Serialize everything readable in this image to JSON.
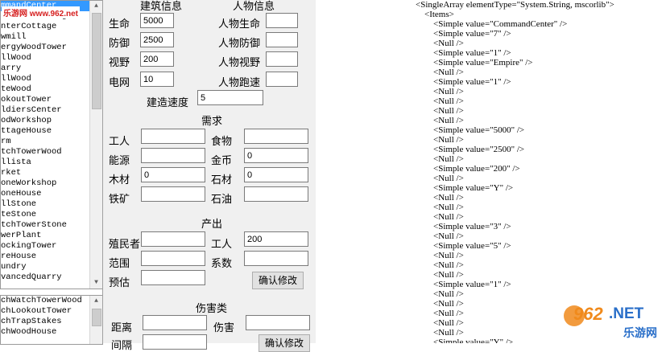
{
  "list_top": {
    "items": [
      "mmandCenter",
      "shermanCottage",
      "nterCottage",
      "wmill",
      "ergyWoodTower",
      "llWood",
      "arry",
      "llWood",
      "teWood",
      "okoutTower",
      "ldiersCenter",
      "odWorkshop",
      "ttageHouse",
      "rm",
      "tchTowerWood",
      "llista",
      "rket",
      "oneWorkshop",
      "oneHouse",
      "llStone",
      "teStone",
      "tchTowerStone",
      "werPlant",
      "ockingTower",
      "reHouse",
      "undry",
      "vancedQuarry"
    ],
    "selected_index": 0
  },
  "list_bottom": {
    "items": [
      "chWatchTowerWood",
      "chLookoutTower",
      "chTrapStakes",
      "chWoodHouse"
    ]
  },
  "watermark_small": "乐游网 www.962.net",
  "form": {
    "building_header": "建筑信息",
    "character_header": "人物信息",
    "building": [
      {
        "label": "生命",
        "value": "5000"
      },
      {
        "label": "防御",
        "value": "2500"
      },
      {
        "label": "视野",
        "value": "200"
      },
      {
        "label": "电网",
        "value": "10"
      }
    ],
    "character": [
      {
        "label": "人物生命",
        "value": ""
      },
      {
        "label": "人物防御",
        "value": ""
      },
      {
        "label": "人物视野",
        "value": ""
      },
      {
        "label": "人物跑速",
        "value": ""
      }
    ],
    "build_speed": {
      "label": "建造速度",
      "value": "5"
    },
    "needs_header": "需求",
    "needs": [
      {
        "label": "工人",
        "value": ""
      },
      {
        "label": "食物",
        "value": ""
      },
      {
        "label": "能源",
        "value": ""
      },
      {
        "label": "金币",
        "value": "0"
      },
      {
        "label": "木材",
        "value": "0"
      },
      {
        "label": "石材",
        "value": "0"
      },
      {
        "label": "铁矿",
        "value": ""
      },
      {
        "label": "石油",
        "value": ""
      }
    ],
    "output_header": "产出",
    "output": [
      {
        "label": "殖民者",
        "value": ""
      },
      {
        "label": "工人",
        "value": "200"
      },
      {
        "label": "范围",
        "value": ""
      },
      {
        "label": "系数",
        "value": ""
      },
      {
        "label": "预估",
        "value": ""
      }
    ],
    "confirm_label": "确认修改",
    "damage_header": "伤害类",
    "damage": [
      {
        "label": "距离",
        "value": ""
      },
      {
        "label": "伤害",
        "value": ""
      },
      {
        "label": "间隔",
        "value": ""
      }
    ],
    "confirm2_label": "确认修改"
  },
  "xml": {
    "lines": [
      {
        "indent": 0,
        "text": "<SingleArray elementType=\"System.String, mscorlib\">"
      },
      {
        "indent": 1,
        "text": "<Items>"
      },
      {
        "indent": 2,
        "text": "<Simple value=\"CommandCenter\" />"
      },
      {
        "indent": 2,
        "text": "<Simple value=\"7\" />"
      },
      {
        "indent": 2,
        "text": "<Null />"
      },
      {
        "indent": 2,
        "text": "<Simple value=\"1\" />"
      },
      {
        "indent": 2,
        "text": "<Simple value=\"Empire\" />"
      },
      {
        "indent": 2,
        "text": "<Null />"
      },
      {
        "indent": 2,
        "text": "<Simple value=\"1\" />"
      },
      {
        "indent": 2,
        "text": "<Null />"
      },
      {
        "indent": 2,
        "text": "<Null />"
      },
      {
        "indent": 2,
        "text": "<Null />"
      },
      {
        "indent": 2,
        "text": "<Null />"
      },
      {
        "indent": 2,
        "text": "<Simple value=\"5000\" />"
      },
      {
        "indent": 2,
        "text": "<Null />"
      },
      {
        "indent": 2,
        "text": "<Simple value=\"2500\" />"
      },
      {
        "indent": 2,
        "text": "<Null />"
      },
      {
        "indent": 2,
        "text": "<Simple value=\"200\" />"
      },
      {
        "indent": 2,
        "text": "<Null />"
      },
      {
        "indent": 2,
        "text": "<Simple value=\"Y\" />"
      },
      {
        "indent": 2,
        "text": "<Null />"
      },
      {
        "indent": 2,
        "text": "<Null />"
      },
      {
        "indent": 2,
        "text": "<Null />"
      },
      {
        "indent": 2,
        "text": "<Simple value=\"3\" />"
      },
      {
        "indent": 2,
        "text": "<Null />"
      },
      {
        "indent": 2,
        "text": "<Simple value=\"5\" />"
      },
      {
        "indent": 2,
        "text": "<Null />"
      },
      {
        "indent": 2,
        "text": "<Null />"
      },
      {
        "indent": 2,
        "text": "<Null />"
      },
      {
        "indent": 2,
        "text": "<Simple value=\"1\" />"
      },
      {
        "indent": 2,
        "text": "<Null />"
      },
      {
        "indent": 2,
        "text": "<Null />"
      },
      {
        "indent": 2,
        "text": "<Null />"
      },
      {
        "indent": 2,
        "text": "<Null />"
      },
      {
        "indent": 2,
        "text": "<Null />"
      },
      {
        "indent": 2,
        "text": "<Simple value=\"Y\" />"
      }
    ]
  },
  "watermark_large": {
    "number": "962",
    "dot_net": ".NET",
    "cn": "乐游网"
  },
  "colors": {
    "selection": "#3399ff",
    "form_bg": "#f0f0f0",
    "watermark_orange": "#f08a1c",
    "watermark_blue": "#2a6fc9"
  }
}
